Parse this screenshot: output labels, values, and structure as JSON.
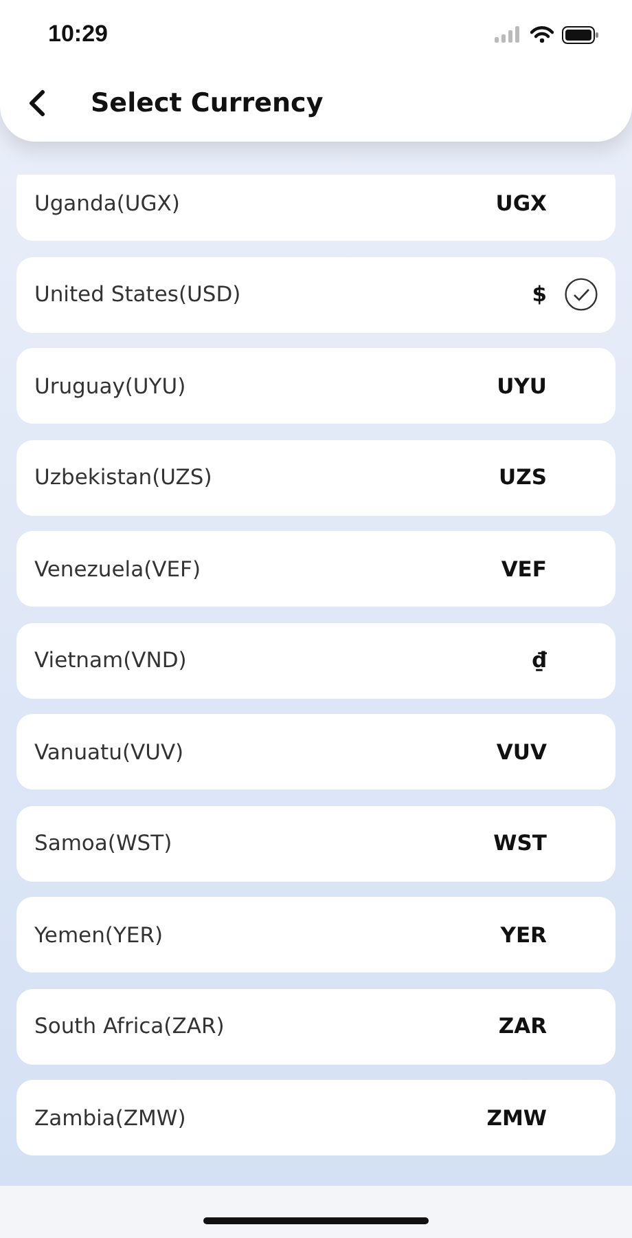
{
  "status_bar": {
    "time": "10:29"
  },
  "header": {
    "title": "Select Currency"
  },
  "currencies": [
    {
      "name": "Uganda(UGX)",
      "code": "UGX",
      "selected": false
    },
    {
      "name": "United States(USD)",
      "code": "$",
      "selected": true
    },
    {
      "name": "Uruguay(UYU)",
      "code": "UYU",
      "selected": false
    },
    {
      "name": "Uzbekistan(UZS)",
      "code": "UZS",
      "selected": false
    },
    {
      "name": "Venezuela(VEF)",
      "code": "VEF",
      "selected": false
    },
    {
      "name": "Vietnam(VND)",
      "code": "₫",
      "selected": false
    },
    {
      "name": "Vanuatu(VUV)",
      "code": "VUV",
      "selected": false
    },
    {
      "name": "Samoa(WST)",
      "code": "WST",
      "selected": false
    },
    {
      "name": "Yemen(YER)",
      "code": "YER",
      "selected": false
    },
    {
      "name": "South Africa(ZAR)",
      "code": "ZAR",
      "selected": false
    },
    {
      "name": "Zambia(ZMW)",
      "code": "ZMW",
      "selected": false
    }
  ]
}
